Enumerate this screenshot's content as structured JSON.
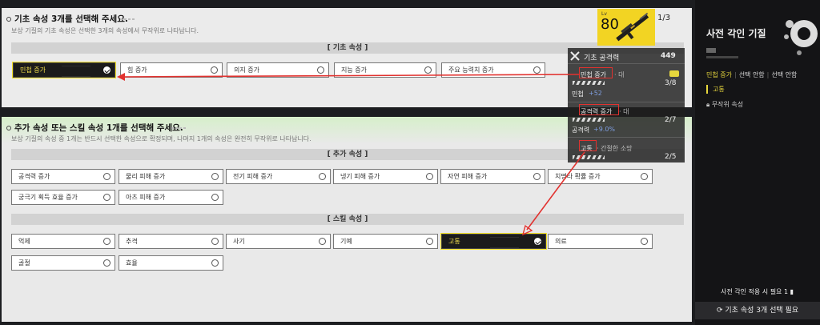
{
  "base": {
    "title": "기초 속성 3개를 선택해 주세요.",
    "subtitle": "보상 기질의 기초 속성은 선택한 3개의 속성에서 무작위로 나타납니다.",
    "section": "[ 기초 속성 ]",
    "options": [
      {
        "label": "민첩 증가",
        "selected": true
      },
      {
        "label": "힘 증가",
        "selected": false
      },
      {
        "label": "의지 증가",
        "selected": false
      },
      {
        "label": "지능 증가",
        "selected": false
      },
      {
        "label": "주요 능력치 증가",
        "selected": false
      }
    ]
  },
  "extra": {
    "title": "추가 속성 또는 스킬 속성 1개를 선택해 주세요.",
    "subtitle": "보상 기질의 속성 중 1개는 반드시 선택한 속성으로 확정되며, 나머지 1개의 속성은 완전히 무작위로 나타납니다.",
    "section_extra": "[ 추가 속성 ]",
    "section_skill": "[ 스킬 속성 ]",
    "extra_row1": [
      "공격력 증가",
      "물리 피해 증가",
      "전기 피해 증가",
      "냉기 피해 증가",
      "자연 피해 증가",
      "치명타 확률 증가"
    ],
    "extra_row2": [
      "궁극기 획득 효율 증가",
      "아츠 피해 증가"
    ],
    "skill_row1": [
      {
        "label": "억제",
        "selected": false
      },
      {
        "label": "추격",
        "selected": false
      },
      {
        "label": "사기",
        "selected": false
      },
      {
        "label": "기예",
        "selected": false
      },
      {
        "label": "고통",
        "selected": true
      },
      {
        "label": "의료",
        "selected": false
      }
    ],
    "skill_row2": [
      "골절",
      "효율"
    ]
  },
  "weapon": {
    "lv_label": "Lv",
    "level": "80",
    "count": "1/3"
  },
  "tooltip": {
    "header": "기초 공격력",
    "header_value": "449",
    "stat1_name": "민첩 증가",
    "stat1_suffix": "· 대",
    "stat1_progress": "3/8",
    "stat1_detail_label": "민첩",
    "stat1_detail_value": "+52",
    "stat2_name": "공격력 증가",
    "stat2_suffix": "· 대",
    "stat2_progress": "2/7",
    "stat2_detail_label": "공격력",
    "stat2_detail_value": "+9.0%",
    "stat3_name": "고통",
    "stat3_suffix": "· 간절한 소망",
    "stat3_progress": "2/5"
  },
  "sidebar": {
    "title": "사전 각인 기질",
    "stat1": "민첩 증가",
    "stat2": "선택 안함",
    "stat3": "선택 안함",
    "goto": "고통",
    "random": "무작위 속성",
    "need_label": "사전 각인 적용 시 필요",
    "need_count": "1",
    "button": "기초 속성 3개 선택 필요"
  },
  "colors": {
    "accent_yellow": "#f5e22a",
    "annotation_red": "#e2322f",
    "selected_bg": "#1b1b1b"
  }
}
